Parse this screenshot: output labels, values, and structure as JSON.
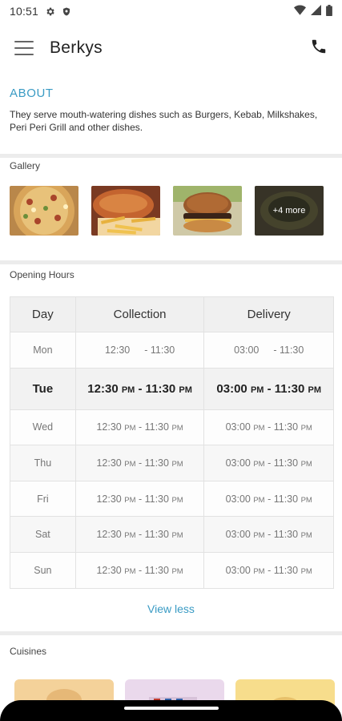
{
  "status_bar": {
    "time": "10:51"
  },
  "app_bar": {
    "title": "Berkys"
  },
  "about": {
    "heading": "ABOUT",
    "description": "They serve mouth-watering dishes such as Burgers, Kebab, Milkshakes, Peri Peri Grill and other dishes."
  },
  "gallery": {
    "label": "Gallery",
    "more_label": "+4 more"
  },
  "opening_hours": {
    "label": "Opening Hours",
    "headers": {
      "day": "Day",
      "collection": "Collection",
      "delivery": "Delivery"
    },
    "rows": [
      {
        "day": "Mon",
        "col_open": "12:30",
        "col_open_ampm": "",
        "col_close": "- 11:30",
        "col_close_ampm": "",
        "del_open": "03:00",
        "del_open_ampm": "",
        "del_close": "- 11:30",
        "del_close_ampm": ""
      },
      {
        "day": "Tue",
        "col_open": "12:30",
        "col_open_ampm": "PM",
        "col_close": "- 11:30",
        "col_close_ampm": "PM",
        "del_open": "03:00",
        "del_open_ampm": "PM",
        "del_close": "- 11:30",
        "del_close_ampm": "PM"
      },
      {
        "day": "Wed",
        "col_open": "12:30",
        "col_open_ampm": "PM",
        "col_close": "- 11:30",
        "col_close_ampm": "PM",
        "del_open": "03:00",
        "del_open_ampm": "PM",
        "del_close": "- 11:30",
        "del_close_ampm": "PM"
      },
      {
        "day": "Thu",
        "col_open": "12:30",
        "col_open_ampm": "PM",
        "col_close": "- 11:30",
        "col_close_ampm": "PM",
        "del_open": "03:00",
        "del_open_ampm": "PM",
        "del_close": "- 11:30",
        "del_close_ampm": "PM"
      },
      {
        "day": "Fri",
        "col_open": "12:30",
        "col_open_ampm": "PM",
        "col_close": "- 11:30",
        "col_close_ampm": "PM",
        "del_open": "03:00",
        "del_open_ampm": "PM",
        "del_close": "- 11:30",
        "del_close_ampm": "PM"
      },
      {
        "day": "Sat",
        "col_open": "12:30",
        "col_open_ampm": "PM",
        "col_close": "- 11:30",
        "col_close_ampm": "PM",
        "del_open": "03:00",
        "del_open_ampm": "PM",
        "del_close": "- 11:30",
        "del_close_ampm": "PM"
      },
      {
        "day": "Sun",
        "col_open": "12:30",
        "col_open_ampm": "PM",
        "col_close": "- 11:30",
        "col_close_ampm": "PM",
        "del_open": "03:00",
        "del_open_ampm": "PM",
        "del_close": "- 11:30",
        "del_close_ampm": "PM"
      }
    ],
    "view_less_label": "View less"
  },
  "cuisines": {
    "label": "Cuisines"
  },
  "colors": {
    "accent": "#3a9bc4",
    "divider": "#ececec",
    "table_header_bg": "#f0f0f0",
    "card_1": "#f4d29a",
    "card_2": "#ead9ec",
    "card_3": "#f7dd8c"
  }
}
